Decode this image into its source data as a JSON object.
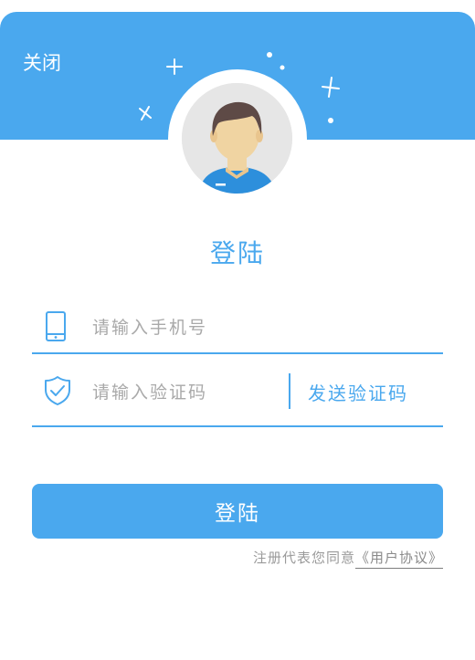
{
  "header": {
    "close_label": "关闭",
    "background_color": "#4aa8ee"
  },
  "avatar": {
    "icon": "user-avatar-icon"
  },
  "title": "登陆",
  "phone": {
    "icon": "mobile-phone-icon",
    "placeholder": "请输入手机号",
    "value": ""
  },
  "code": {
    "icon": "shield-check-icon",
    "placeholder": "请输入验证码",
    "value": "",
    "send_label": "发送验证码"
  },
  "login_button_label": "登陆",
  "agreement": {
    "prefix": "注册代表您同意",
    "link_label": "《用户协议》"
  },
  "colors": {
    "accent": "#4aa8ee",
    "muted_text": "#a9a9a9"
  }
}
